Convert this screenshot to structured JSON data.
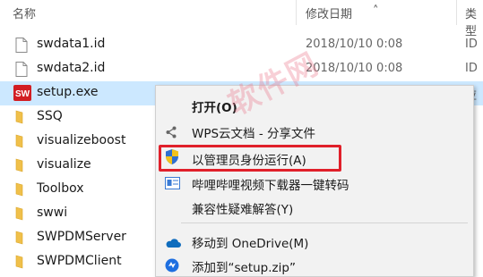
{
  "header": {
    "col_name": "名称",
    "col_date": "修改日期",
    "col_type": "类型"
  },
  "files": [
    {
      "name": "swdata1.id",
      "date": "2018/10/10 0:08",
      "type": "ID",
      "icon": "file-icon"
    },
    {
      "name": "swdata2.id",
      "date": "2018/10/10 0:08",
      "type": "ID",
      "icon": "file-icon"
    },
    {
      "name": "setup.exe",
      "date": "",
      "type": "应",
      "icon": "solidworks-app-icon",
      "selected": true
    },
    {
      "name": "SSQ",
      "icon": "folder-icon"
    },
    {
      "name": "visualizeboost",
      "icon": "folder-icon"
    },
    {
      "name": "visualize",
      "icon": "folder-icon"
    },
    {
      "name": "Toolbox",
      "icon": "folder-icon"
    },
    {
      "name": "swwi",
      "icon": "folder-icon"
    },
    {
      "name": "SWPDMServer",
      "icon": "folder-icon"
    },
    {
      "name": "SWPDMClient",
      "icon": "folder-icon"
    }
  ],
  "context_menu": {
    "open": "打开(O)",
    "wps_share": "WPS云文档 - 分享文件",
    "run_as_admin": "以管理员身份运行(A)",
    "bilibili_convert": "哔哩哔哩视频下载器一键转码",
    "compat_troubleshoot": "兼容性疑难解答(Y)",
    "move_onedrive": "移动到 OneDrive(M)",
    "add_to_zip": "添加到“setup.zip”"
  },
  "watermark": "软件网",
  "colors": {
    "selection": "#cce8ff",
    "highlight_box": "#e0202a",
    "menu_bg": "#f2f2f2"
  }
}
